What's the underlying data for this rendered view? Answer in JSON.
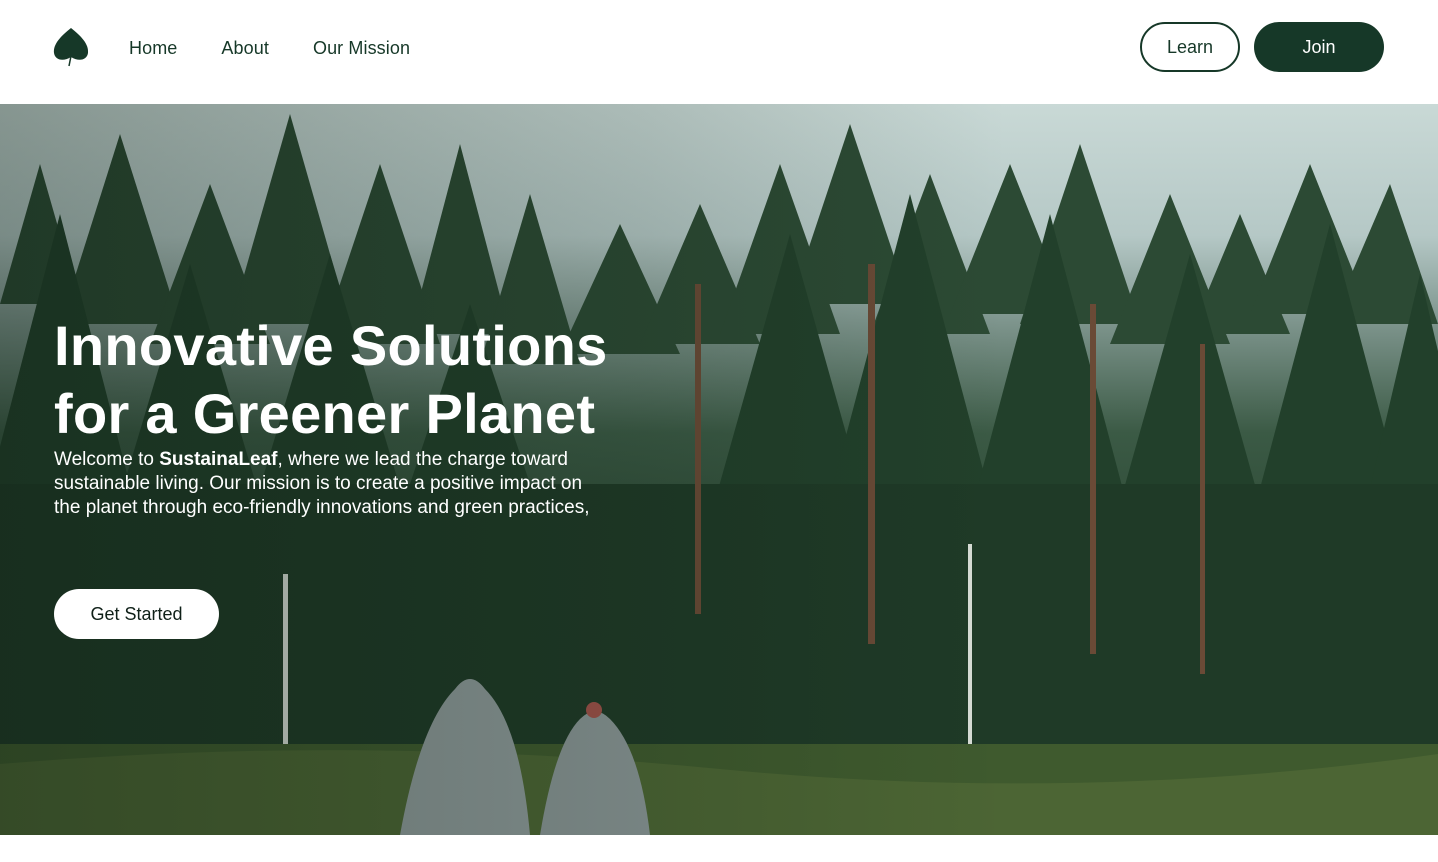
{
  "nav": {
    "logo_icon": "leaf-icon",
    "links": [
      "Home",
      "About",
      "Our Mission"
    ],
    "learn_label": "Learn",
    "join_label": "Join"
  },
  "hero": {
    "title_line1": "Innovative Solutions",
    "title_line2": "for a Greener Planet",
    "text_prefix": "Welcome to ",
    "brand": "SustainaLeaf",
    "text_suffix": ", where we lead the charge toward sustainable living. Our mission is to create a positive impact on the planet through eco-friendly innovations and green practices,",
    "cta_label": "Get Started",
    "background_image": "forest-hikers-photo"
  },
  "colors": {
    "brand_dark_green": "#163828",
    "white": "#ffffff"
  }
}
